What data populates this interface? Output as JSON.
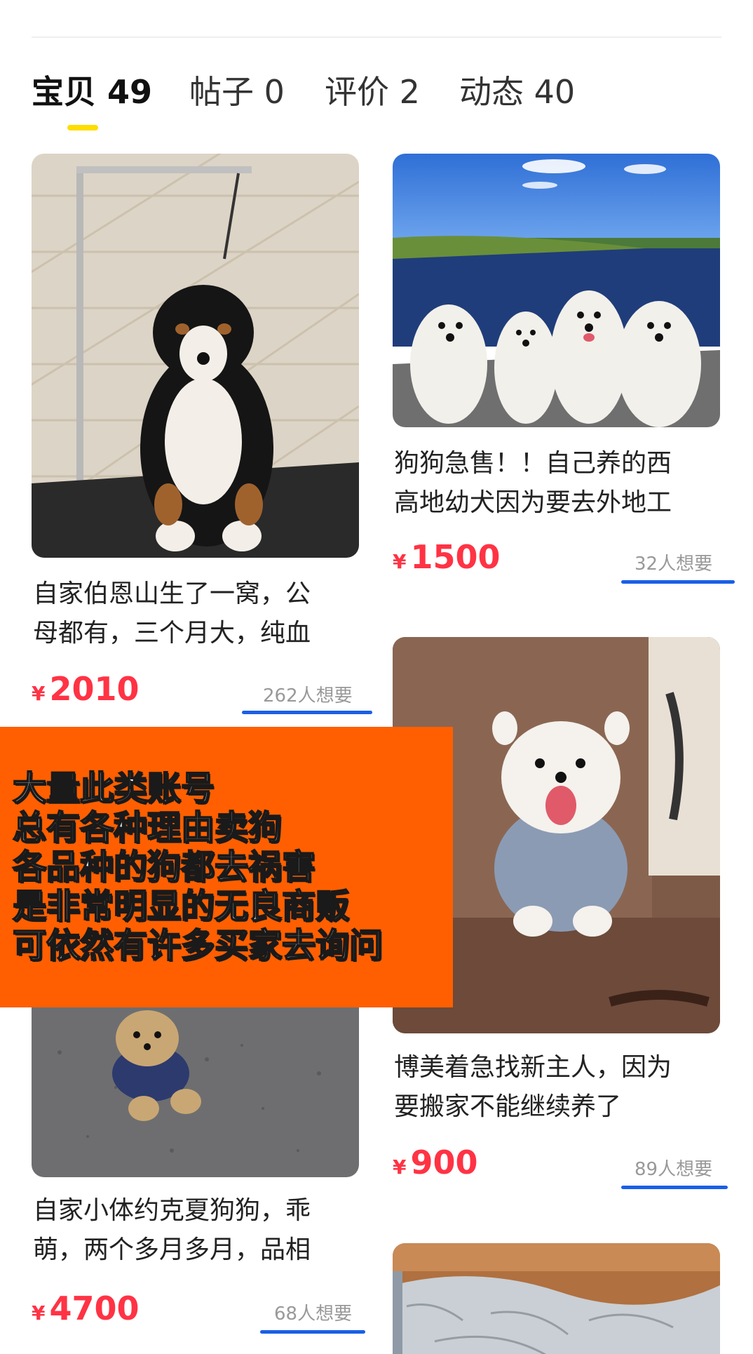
{
  "tabs": [
    {
      "label": "宝贝 49",
      "active": true
    },
    {
      "label": "帖子 0",
      "active": false
    },
    {
      "label": "评价 2",
      "active": false
    },
    {
      "label": "动态 40",
      "active": false
    }
  ],
  "items": [
    {
      "title_line1": "自家伯恩山生了一窝，公",
      "title_line2": "母都有，三个月大，纯血",
      "currency": "¥",
      "price": "2010",
      "want": "262人想要",
      "image": "bernese-puppy"
    },
    {
      "title_line1": "狗狗急售！！自己养的西",
      "title_line2": "高地幼犬因为要去外地工",
      "currency": "¥",
      "price": "1500",
      "want": "32人想要",
      "image": "westie-dogs-by-lake"
    },
    {
      "title_line1": "博美着急找新主人，因为",
      "title_line2": "要搬家不能继续养了",
      "currency": "¥",
      "price": "900",
      "want": "89人想要",
      "image": "pomeranian-in-sweater"
    },
    {
      "title_line1": "自家小体约克夏狗狗，乖",
      "title_line2": "萌，两个多月多月，品相",
      "currency": "¥",
      "price": "4700",
      "want": "68人想要",
      "image": "yorkshire-puppy"
    },
    {
      "image": "dog-in-bag"
    }
  ],
  "banner_lines": [
    "大量此类账号",
    "总有各种理由卖狗",
    "各品种的狗都去祸害",
    "是非常明显的无良商贩",
    "可依然有许多买家去询问"
  ],
  "colors": {
    "price": "#ff3344",
    "accent_yellow": "#ffdd00",
    "want_underline": "#1a5fe6",
    "banner": "#ff5f00"
  }
}
